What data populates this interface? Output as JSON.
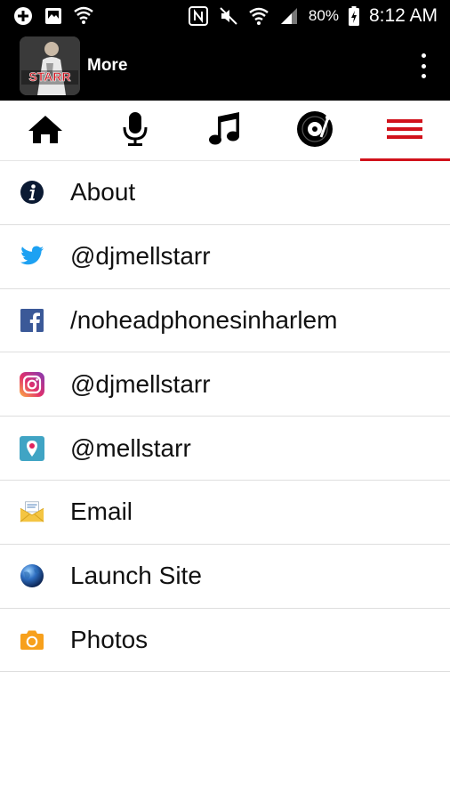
{
  "status_bar": {
    "battery_percent": "80%",
    "time": "8:12 AM"
  },
  "app_bar": {
    "title": "More",
    "logo_text": "STARR"
  },
  "tabs": [
    {
      "icon": "home-icon",
      "active": false
    },
    {
      "icon": "microphone-icon",
      "active": false
    },
    {
      "icon": "music-note-icon",
      "active": false
    },
    {
      "icon": "vinyl-record-icon",
      "active": false
    },
    {
      "icon": "menu-icon",
      "active": true
    }
  ],
  "accent_color": "#d1121b",
  "menu": {
    "items": [
      {
        "label": "About",
        "icon": "info-icon"
      },
      {
        "label": "@djmellstarr",
        "icon": "twitter-icon"
      },
      {
        "label": "/noheadphonesinharlem",
        "icon": "facebook-icon"
      },
      {
        "label": "@djmellstarr",
        "icon": "instagram-icon"
      },
      {
        "label": "@mellstarr",
        "icon": "periscope-icon"
      },
      {
        "label": "Email",
        "icon": "email-icon"
      },
      {
        "label": "Launch Site",
        "icon": "globe-icon"
      },
      {
        "label": "Photos",
        "icon": "camera-icon"
      }
    ]
  }
}
